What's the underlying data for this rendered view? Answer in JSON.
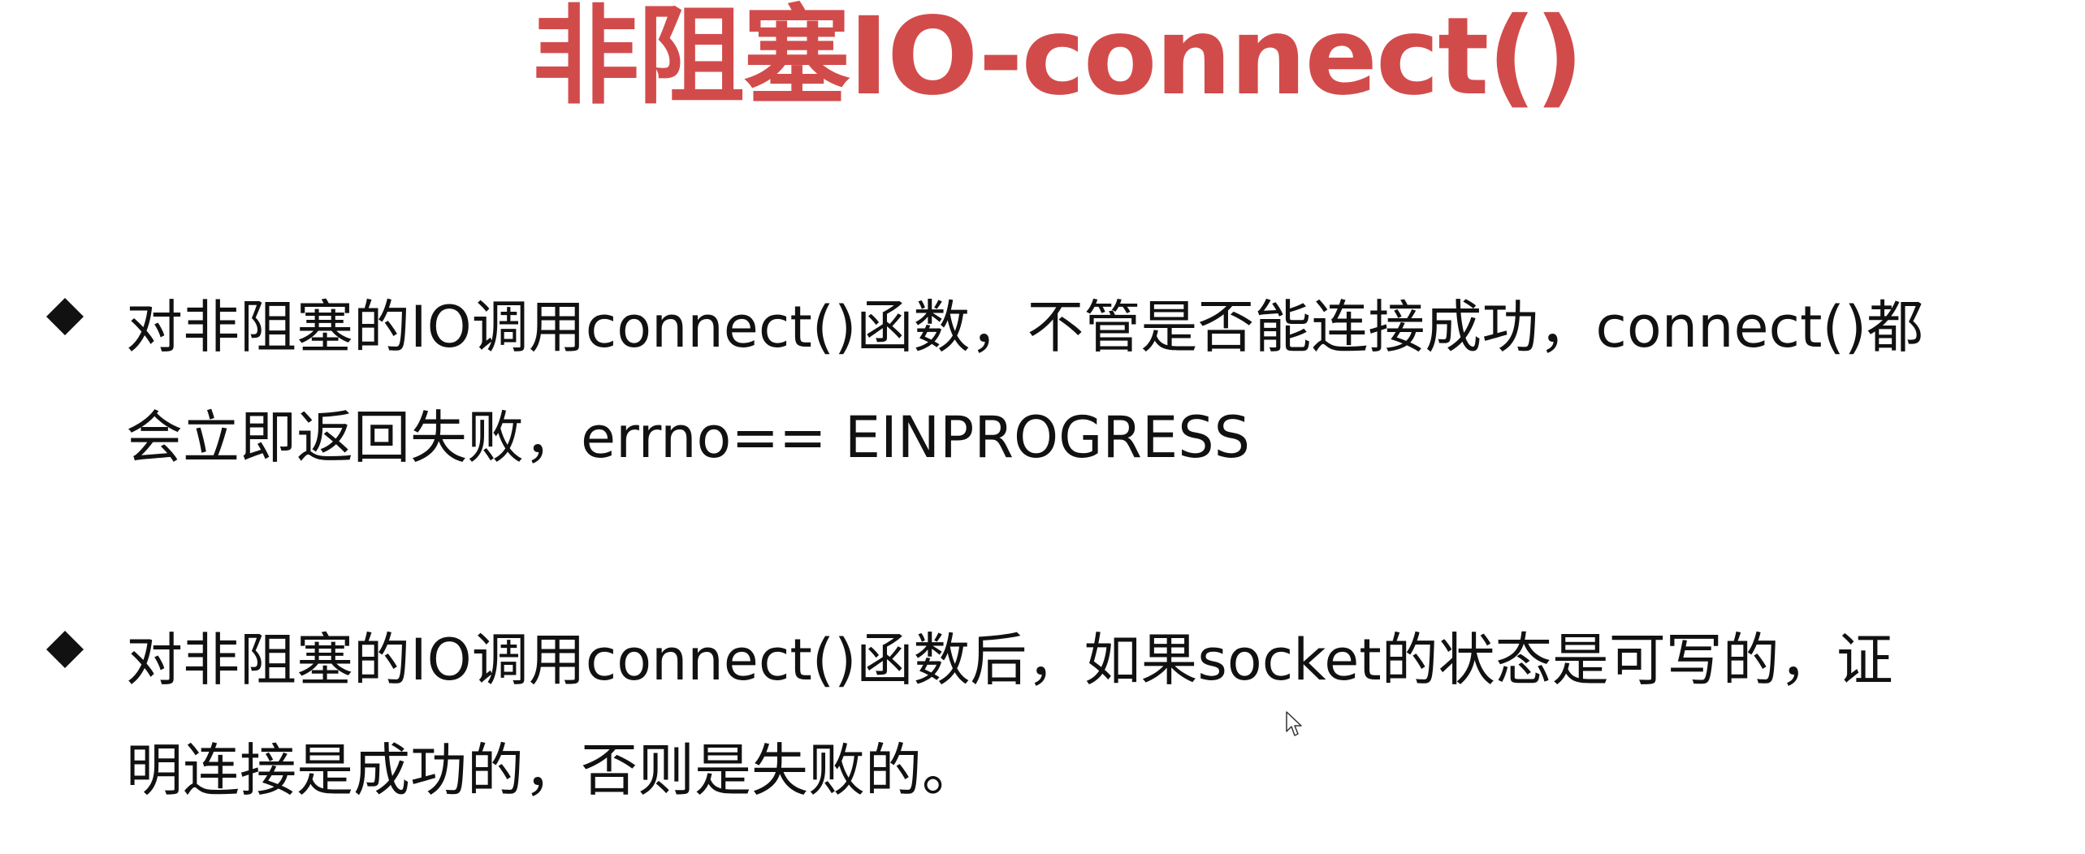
{
  "title": "非阻塞IO-connect()",
  "colors": {
    "title": "#d24b4b",
    "text": "#111111",
    "background": "#ffffff"
  },
  "bullets": [
    {
      "icon": "diamond-bullet-icon",
      "lines": [
        "对非阻塞的IO调用connect()函数，不管是否能连接成功，connect()都",
        "会立即返回失败，errno== EINPROGRESS"
      ]
    },
    {
      "icon": "diamond-bullet-icon",
      "lines": [
        "对非阻塞的IO调用connect()函数后，如果socket的状态是可写的，证",
        "明连接是成功的，否则是失败的。"
      ]
    }
  ],
  "cursor": {
    "icon": "mouse-pointer-icon"
  }
}
